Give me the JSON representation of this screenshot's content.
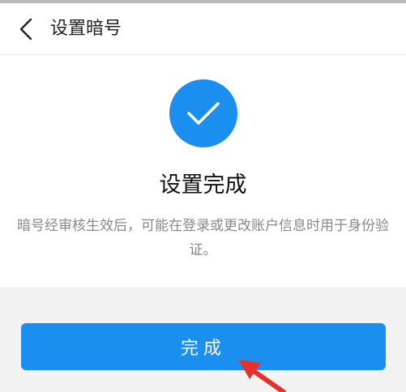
{
  "header": {
    "title": "设置暗号",
    "back_icon": "chevron-left-icon"
  },
  "result": {
    "icon": "check-icon",
    "title": "设置完成",
    "description": "暗号经审核生效后，可能在登录或更改账户信息时用于身份验证。"
  },
  "actions": {
    "done_label": "完成"
  },
  "colors": {
    "accent": "#1a8ff0",
    "annotation": "#e8302a"
  }
}
